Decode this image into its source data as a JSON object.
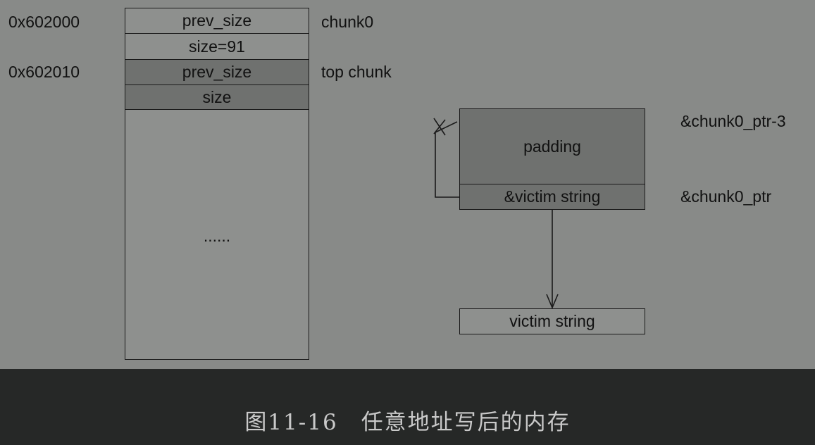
{
  "addresses": {
    "chunk0_addr": "0x602000",
    "top_addr": "0x602010"
  },
  "heap": {
    "chunk0_prev_size": "prev_size",
    "chunk0_size": "size=91",
    "top_prev_size": "prev_size",
    "top_size": "size",
    "ellipsis": "......"
  },
  "labels": {
    "chunk0": "chunk0",
    "top_chunk": "top chunk",
    "ptr_minus_3": "&chunk0_ptr-3",
    "ptr": "&chunk0_ptr"
  },
  "pointer_struct": {
    "padding": "padding",
    "victim_ptr": "&victim string"
  },
  "victim": {
    "label": "victim string"
  },
  "caption": "图11-16　任意地址写后的内存",
  "colors": {
    "background": "#888a88",
    "dark_cell": "#6f716f",
    "light_cell": "#8e908e",
    "footer": "#262827",
    "caption_text": "#c9c9c9"
  }
}
